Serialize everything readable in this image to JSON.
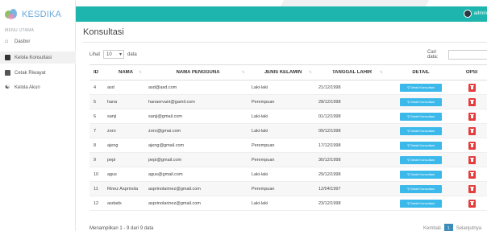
{
  "brand": {
    "name": "KESDIKA"
  },
  "sidebar": {
    "menu_title": "MENU UTAMA",
    "items": [
      {
        "label": "Dasbor",
        "icon": "home-icon"
      },
      {
        "label": "Kelola Konsultasi",
        "icon": "document-icon"
      },
      {
        "label": "Cetak Riwayat",
        "icon": "print-icon"
      },
      {
        "label": "Kelola Akun",
        "icon": "users-icon"
      }
    ]
  },
  "header": {
    "user_label": "admin",
    "color": "#1db5ad"
  },
  "page": {
    "title": "Konsultasi"
  },
  "controls": {
    "show_label": "Lihat",
    "show_value": "10",
    "show_suffix": "data",
    "search_label": "Cari data:"
  },
  "table": {
    "columns": [
      "ID",
      "NAMA",
      "NAMA PENGGUNA",
      "JENIS KELAMIN",
      "TANGGAL LAHIR",
      "DETAIL",
      "OPSI"
    ],
    "detail_button_label": "Detail Konsultasi",
    "rows": [
      {
        "id": "4",
        "nama": "asd",
        "pengguna": "asd@asd.com",
        "jk": "Laki-laki",
        "tgl": "21/12/1998"
      },
      {
        "id": "5",
        "nama": "hana",
        "pengguna": "hanaervani@gamil.com",
        "jk": "Perempuan",
        "tgl": "28/12/1998"
      },
      {
        "id": "6",
        "nama": "sanji",
        "pengguna": "sanji@gmail.com",
        "jk": "Laki-laki",
        "tgl": "01/12/1998"
      },
      {
        "id": "7",
        "nama": "zoro",
        "pengguna": "zoro@gmai.com",
        "jk": "Laki-laki",
        "tgl": "09/12/1998"
      },
      {
        "id": "8",
        "nama": "ajeng",
        "pengguna": "ajeng@gmail.com",
        "jk": "Perempuan",
        "tgl": "17/12/1998"
      },
      {
        "id": "9",
        "nama": "pepi",
        "pengguna": "pepi@gmail.com",
        "jk": "Perempuan",
        "tgl": "30/12/1998"
      },
      {
        "id": "10",
        "nama": "agus",
        "pengguna": "agus@gmail.com",
        "jk": "Laki-laki",
        "tgl": "29/12/1998"
      },
      {
        "id": "11",
        "nama": "Rinez Asprinola",
        "pengguna": "asprinolarinez@gmail.com",
        "jk": "Perempuan",
        "tgl": "12/04/1997"
      },
      {
        "id": "12",
        "nama": "asdads",
        "pengguna": "asprinolarinez@gmail.com",
        "jk": "Laki-laki",
        "tgl": "23/12/1998"
      }
    ]
  },
  "footer": {
    "info": "Menampilkan 1 - 9 dari 9 data",
    "prev_label": "Kembali",
    "page": "1",
    "next_label": "Selanjutnya"
  }
}
